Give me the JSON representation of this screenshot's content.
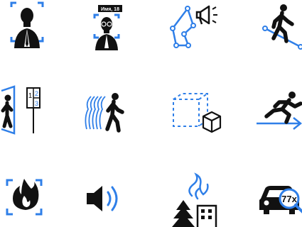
{
  "palette": {
    "accent": "#2f7fe8",
    "ink": "#111111",
    "background": "#ffffff"
  },
  "icons": [
    {
      "name": "face-detection-icon"
    },
    {
      "name": "face-recognition-name-tag-icon",
      "tag_text": "Имя, 18"
    },
    {
      "name": "area-announcement-megaphone-icon"
    },
    {
      "name": "line-crossing-walker-icon"
    },
    {
      "name": "people-counting-door-icon",
      "counter_digits": [
        "1",
        "2",
        "3"
      ]
    },
    {
      "name": "motion-detection-walker-icon"
    },
    {
      "name": "object-left-behind-icon"
    },
    {
      "name": "running-detection-icon"
    },
    {
      "name": "fire-detection-icon"
    },
    {
      "name": "audio-detection-speaker-icon"
    },
    {
      "name": "smoke-detection-forest-icon"
    },
    {
      "name": "license-plate-recognition-icon",
      "plate_text": "77x"
    }
  ]
}
